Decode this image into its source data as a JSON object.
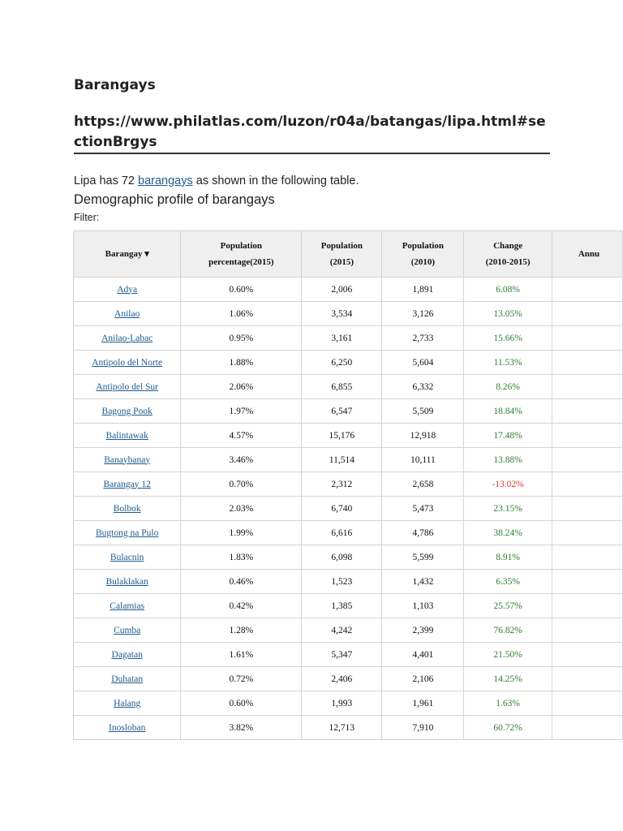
{
  "heading": "Barangays",
  "source_url": "https://www.philatlas.com/luzon/r04a/batangas/lipa.html#sectionBrgys",
  "intro": {
    "before": "Lipa has 72 ",
    "link": "barangays",
    "after": " as shown in the following table."
  },
  "table_caption": "Demographic profile of barangays",
  "filter_label": "Filter:",
  "columns": [
    {
      "line1": "Barangay ▾",
      "line2": ""
    },
    {
      "line1": "Population",
      "line2": "percentage(2015)"
    },
    {
      "line1": "Population",
      "line2": "(2015)"
    },
    {
      "line1": "Population",
      "line2": "(2010)"
    },
    {
      "line1": "Change",
      "line2": "(2010-2015)"
    },
    {
      "line1": "Annu",
      "line2": ""
    }
  ],
  "rows": [
    {
      "name": "Adya",
      "pct": "0.60%",
      "p2015": "2,006",
      "p2010": "1,891",
      "change": "6.08%",
      "dir": "pos"
    },
    {
      "name": "Anilao",
      "pct": "1.06%",
      "p2015": "3,534",
      "p2010": "3,126",
      "change": "13.05%",
      "dir": "pos"
    },
    {
      "name": "Anilao-Labac",
      "pct": "0.95%",
      "p2015": "3,161",
      "p2010": "2,733",
      "change": "15.66%",
      "dir": "pos"
    },
    {
      "name": "Antipolo del Norte",
      "pct": "1.88%",
      "p2015": "6,250",
      "p2010": "5,604",
      "change": "11.53%",
      "dir": "pos"
    },
    {
      "name": "Antipolo del Sur",
      "pct": "2.06%",
      "p2015": "6,855",
      "p2010": "6,332",
      "change": "8.26%",
      "dir": "pos"
    },
    {
      "name": "Bagong Pook",
      "pct": "1.97%",
      "p2015": "6,547",
      "p2010": "5,509",
      "change": "18.84%",
      "dir": "pos"
    },
    {
      "name": "Balintawak",
      "pct": "4.57%",
      "p2015": "15,176",
      "p2010": "12,918",
      "change": "17.48%",
      "dir": "pos"
    },
    {
      "name": "Banaybanay",
      "pct": "3.46%",
      "p2015": "11,514",
      "p2010": "10,111",
      "change": "13.88%",
      "dir": "pos"
    },
    {
      "name": "Barangay 12",
      "pct": "0.70%",
      "p2015": "2,312",
      "p2010": "2,658",
      "change": "-13.02%",
      "dir": "neg"
    },
    {
      "name": "Bolbok",
      "pct": "2.03%",
      "p2015": "6,740",
      "p2010": "5,473",
      "change": "23.15%",
      "dir": "pos"
    },
    {
      "name": "Bugtong na Pulo",
      "pct": "1.99%",
      "p2015": "6,616",
      "p2010": "4,786",
      "change": "38.24%",
      "dir": "pos"
    },
    {
      "name": "Bulacnin",
      "pct": "1.83%",
      "p2015": "6,098",
      "p2010": "5,599",
      "change": "8.91%",
      "dir": "pos"
    },
    {
      "name": "Bulaklakan",
      "pct": "0.46%",
      "p2015": "1,523",
      "p2010": "1,432",
      "change": "6.35%",
      "dir": "pos"
    },
    {
      "name": "Calamias",
      "pct": "0.42%",
      "p2015": "1,385",
      "p2010": "1,103",
      "change": "25.57%",
      "dir": "pos"
    },
    {
      "name": "Cumba",
      "pct": "1.28%",
      "p2015": "4,242",
      "p2010": "2,399",
      "change": "76.82%",
      "dir": "pos"
    },
    {
      "name": "Dagatan",
      "pct": "1.61%",
      "p2015": "5,347",
      "p2010": "4,401",
      "change": "21.50%",
      "dir": "pos"
    },
    {
      "name": "Duhatan",
      "pct": "0.72%",
      "p2015": "2,406",
      "p2010": "2,106",
      "change": "14.25%",
      "dir": "pos"
    },
    {
      "name": "Halang",
      "pct": "0.60%",
      "p2015": "1,993",
      "p2010": "1,961",
      "change": "1.63%",
      "dir": "pos"
    },
    {
      "name": "Inosloban",
      "pct": "3.82%",
      "p2015": "12,713",
      "p2010": "7,910",
      "change": "60.72%",
      "dir": "pos"
    }
  ]
}
